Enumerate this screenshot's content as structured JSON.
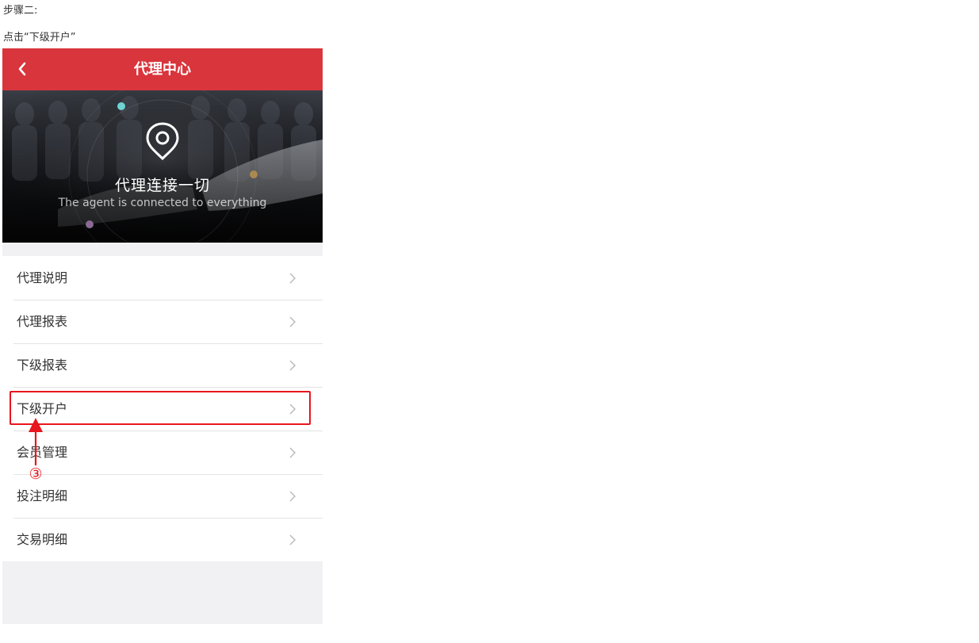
{
  "instructions": {
    "step_heading": "步骤二:",
    "step_action": "点击“下级开户”",
    "step_number_glyph": "③"
  },
  "header": {
    "title": "代理中心",
    "back_icon": "chevron-left-icon",
    "background_color": "#d9353c"
  },
  "banner": {
    "title": "代理连接一切",
    "subtitle": "The agent is connected to everything",
    "icon": "location-pin-icon"
  },
  "menu": {
    "items": [
      {
        "label": "代理说明"
      },
      {
        "label": "代理报表"
      },
      {
        "label": "下级报表"
      },
      {
        "label": "下级开户"
      },
      {
        "label": "会员管理"
      },
      {
        "label": "投注明细"
      },
      {
        "label": "交易明细"
      }
    ],
    "chevron_icon": "chevron-right-icon"
  },
  "annotation": {
    "highlight_color": "#e8151d",
    "highlighted_item": "下级开户"
  }
}
